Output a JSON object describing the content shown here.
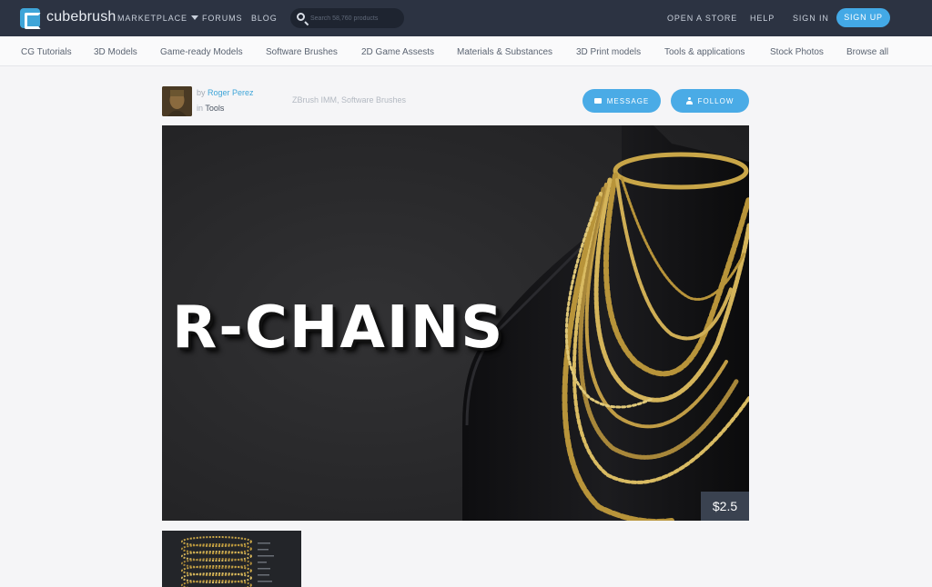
{
  "header": {
    "brand": "cubebrush",
    "nav": [
      {
        "label": "MARKETPLACE"
      },
      {
        "label": "FORUMS"
      },
      {
        "label": "BLOG"
      }
    ],
    "search_placeholder": "Search 58,760 products",
    "right_links": [
      {
        "label": "OPEN A STORE"
      },
      {
        "label": "HELP"
      },
      {
        "label": "SIGN IN"
      }
    ],
    "signup_label": "SIGN UP"
  },
  "categories": [
    "CG Tutorials",
    "3D Models",
    "Game-ready Models",
    "Software Brushes",
    "2D Game Assests",
    "Materials & Substances",
    "3D Print models",
    "Tools & applications",
    "Stock Photos",
    "Browse all"
  ],
  "product": {
    "by_prefix": "by",
    "author": "Roger Perez",
    "in_prefix": "in",
    "category": "Tools",
    "tags": "ZBrush IMM, Software Brushes",
    "message_label": "MESSAGE",
    "follow_label": "FOLLOW",
    "hero_title": "R-CHAINS",
    "price": "$2.5"
  },
  "colors": {
    "topbar": "#2c3342",
    "accent": "#43a9e6",
    "gold": "#c9a648"
  }
}
